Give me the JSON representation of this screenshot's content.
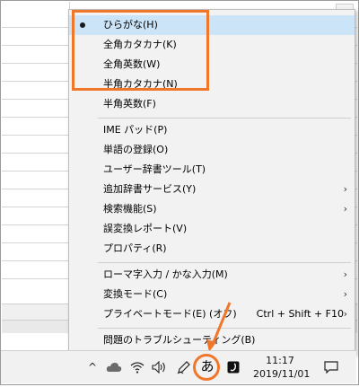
{
  "menu": {
    "items": [
      {
        "label": "ひらがな(H)",
        "checked": true
      },
      {
        "label": "全角カタカナ(K)"
      },
      {
        "label": "全角英数(W)"
      },
      {
        "label": "半角カタカナ(N)"
      },
      {
        "label": "半角英数(F)"
      },
      {
        "label": "IME パッド(P)"
      },
      {
        "label": "単語の登録(O)"
      },
      {
        "label": "ユーザー辞書ツール(T)"
      },
      {
        "label": "追加辞書サービス(Y)"
      },
      {
        "label": "検索機能(S)"
      },
      {
        "label": "誤変換レポート(V)"
      },
      {
        "label": "プロパティ(R)"
      },
      {
        "label": "ローマ字入力 / かな入力(M)"
      },
      {
        "label": "変換モード(C)"
      },
      {
        "label": "プライベートモード(E) (オフ)",
        "shortcut": "Ctrl + Shift + F10"
      },
      {
        "label": "問題のトラブルシューティング(B)"
      }
    ],
    "submenu_arrow": "›"
  },
  "taskbar": {
    "chevron": "^",
    "ime_mode": "あ",
    "time": "11:17",
    "date": "2019/11/01"
  },
  "colors": {
    "highlight": "#f0772a",
    "selected_row": "#cce4f7",
    "menu_bg": "#f2f2f2"
  }
}
